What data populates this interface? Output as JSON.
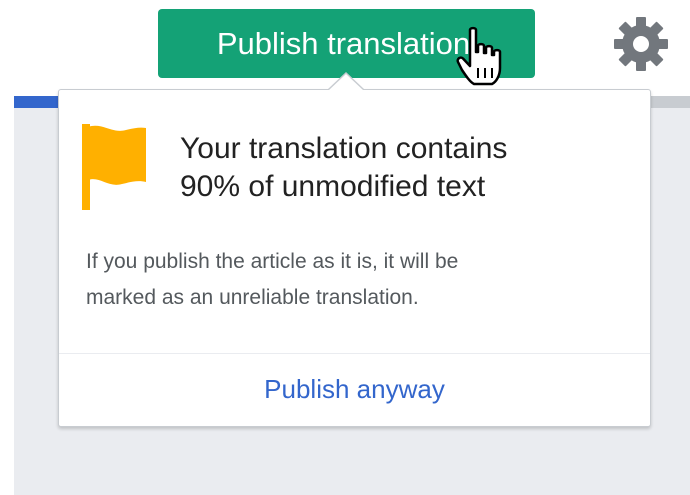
{
  "header": {
    "publish_button_label": "Publish translation",
    "settings_icon": "gear-icon"
  },
  "popup": {
    "icon": "flag-icon",
    "title_line1": "Your translation contains",
    "title_line2": "90% of unmodified text",
    "body_line1": "If you publish the article as it is, it will be",
    "body_line2": "marked as an unreliable translation.",
    "action_label": "Publish anyway"
  },
  "colors": {
    "primary_button": "#14a276",
    "flag": "#ffb000",
    "link": "#3366cc",
    "gear": "#72777d"
  }
}
